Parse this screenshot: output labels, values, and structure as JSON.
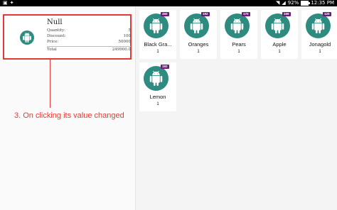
{
  "status_bar": {
    "battery_text": "92%",
    "battery_level": 0.92,
    "time": "12:35 PM"
  },
  "order": {
    "title": "Null",
    "rows": [
      {
        "label": "Quantity:",
        "value": "5"
      },
      {
        "label": "Discount:",
        "value": "100"
      },
      {
        "label": "Price:",
        "value": "50000"
      }
    ],
    "total_label": "Total",
    "total_value": "249900.0"
  },
  "annotation": "3. On clicking its value changed",
  "products": [
    {
      "name": "Black Gra...",
      "qty": "1",
      "badge": "450"
    },
    {
      "name": "Oranges",
      "qty": "1",
      "badge": "192"
    },
    {
      "name": "Pears",
      "qty": "1",
      "badge": "170"
    },
    {
      "name": "Apple",
      "qty": "1",
      "badge": "169"
    },
    {
      "name": "Jonagold",
      "qty": "1",
      "badge": "120"
    },
    {
      "name": "Lemon",
      "qty": "1",
      "badge": "192"
    }
  ],
  "colors": {
    "accent": "#2e8b80",
    "badge": "#6a1b7a",
    "highlight": "#e53935"
  }
}
